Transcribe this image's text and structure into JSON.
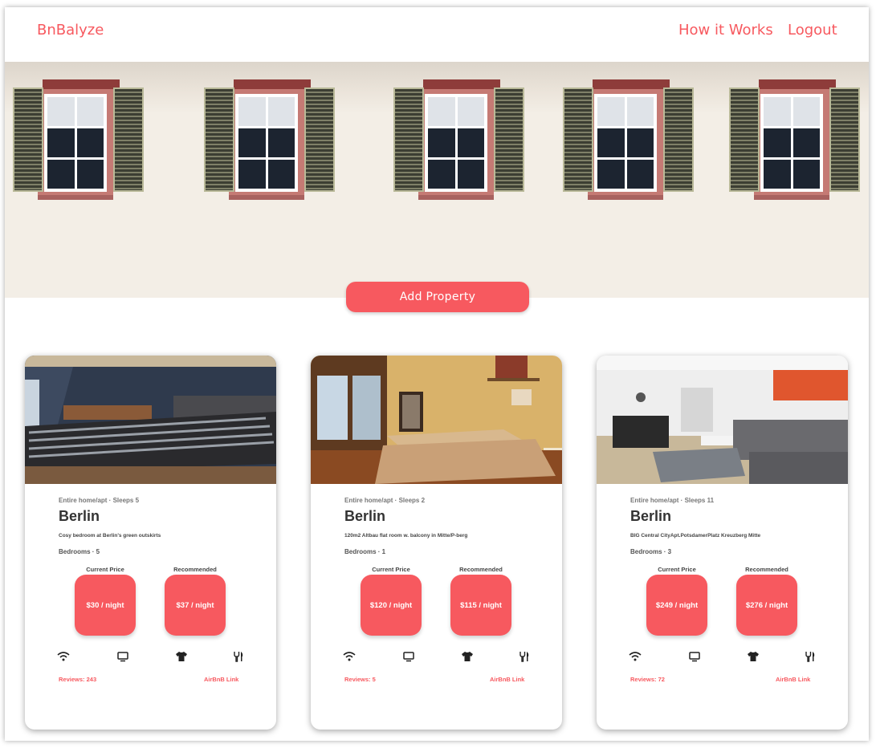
{
  "nav": {
    "brand": "BnBalyze",
    "links": [
      {
        "label": "How it Works"
      },
      {
        "label": "Logout"
      }
    ]
  },
  "hero": {
    "add_button": "Add Property"
  },
  "cards": [
    {
      "room_type": "Entire home/apt · Sleeps 5",
      "city": "Berlin",
      "description": "Cosy bedroom at Berlin's green outskirts",
      "bedrooms": "Bedrooms · 5",
      "current_label": "Current Price",
      "current_price": "$30 / night",
      "recommended_label": "Recommended",
      "recommended_price": "$37 / night",
      "reviews": "Reviews: 243",
      "link": "AirBnB Link"
    },
    {
      "room_type": "Entire home/apt · Sleeps 2",
      "city": "Berlin",
      "description": "120m2 Altbau flat room w. balcony in Mitte/P-berg",
      "bedrooms": "Bedrooms · 1",
      "current_label": "Current Price",
      "current_price": "$120 / night",
      "recommended_label": "Recommended",
      "recommended_price": "$115 / night",
      "reviews": "Reviews: 5",
      "link": "AirBnB Link"
    },
    {
      "room_type": "Entire home/apt · Sleeps 11",
      "city": "Berlin",
      "description": "BIG Central CityApt.PotsdamerPlatz Kreuzberg Mitte",
      "bedrooms": "Bedrooms · 3",
      "current_label": "Current Price",
      "current_price": "$249 / night",
      "recommended_label": "Recommended",
      "recommended_price": "$276 / night",
      "reviews": "Reviews: 72",
      "link": "AirBnB Link"
    }
  ],
  "amenity_icons": [
    "wifi-icon",
    "tv-icon",
    "shirt-icon",
    "utensils-icon"
  ],
  "colors": {
    "accent": "#f7595f",
    "text_dark": "#333333"
  }
}
